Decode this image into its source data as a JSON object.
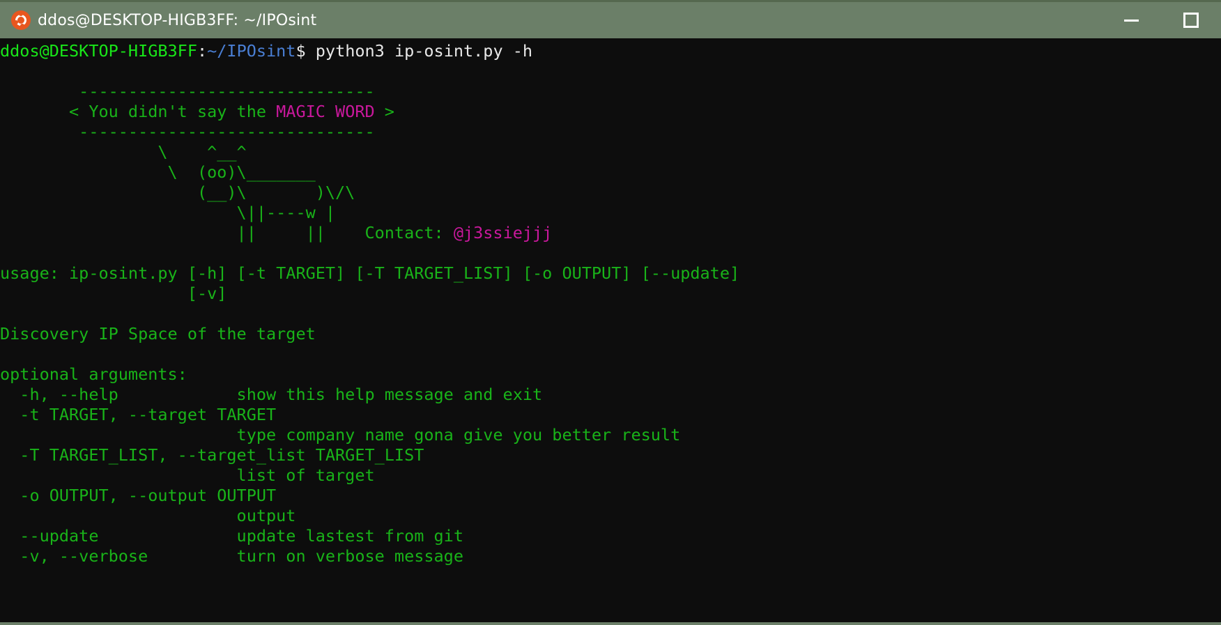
{
  "window": {
    "title": "ddos@DESKTOP-HIGB3FF: ~/IPOsint",
    "app_icon": "ubuntu-logo-icon",
    "controls": {
      "minimize": "minimize-icon",
      "maximize": "maximize-icon"
    }
  },
  "colors": {
    "titlebar_bg": "#6b7f68",
    "terminal_bg": "#0d0d0d",
    "prompt_user": "#19e619",
    "prompt_path": "#4a7fd4",
    "text_white": "#e8e8e8",
    "text_green": "#19b319",
    "text_magenta": "#c9189c"
  },
  "prompt": {
    "user_host": "ddos@DESKTOP-HIGB3FF",
    "separator": ":",
    "path": "~/IPOsint",
    "symbol": "$",
    "command": " python3 ip-osint.py -h"
  },
  "banner": {
    "top_border": "        ------------------------------",
    "speech_open": "       < You didn't say the ",
    "speech_highlight": "MAGIC WORD",
    "speech_close": " >",
    "bottom_border": "        ------------------------------",
    "cow": [
      "                \\    ^__^",
      "                 \\  (oo)\\_______",
      "                    (__)\\       )\\/\\",
      "                        \\||----w |"
    ],
    "contact_line_prefix": "                        ||     ||    Contact: ",
    "contact_handle": "@j3ssiejjj"
  },
  "help": {
    "usage_line_1": "usage: ip-osint.py [-h] [-t TARGET] [-T TARGET_LIST] [-o OUTPUT] [--update]",
    "usage_line_2": "                   [-v]",
    "description": "Discovery IP Space of the target",
    "section_title": "optional arguments:",
    "arguments": [
      {
        "flags": "  -h, --help            show this help message and exit"
      },
      {
        "flags": "  -t TARGET, --target TARGET"
      },
      {
        "flags": "                        type company name gona give you better result"
      },
      {
        "flags": "  -T TARGET_LIST, --target_list TARGET_LIST"
      },
      {
        "flags": "                        list of target"
      },
      {
        "flags": "  -o OUTPUT, --output OUTPUT"
      },
      {
        "flags": "                        output"
      },
      {
        "flags": "  --update              update lastest from git"
      },
      {
        "flags": "  -v, --verbose         turn on verbose message"
      }
    ]
  }
}
